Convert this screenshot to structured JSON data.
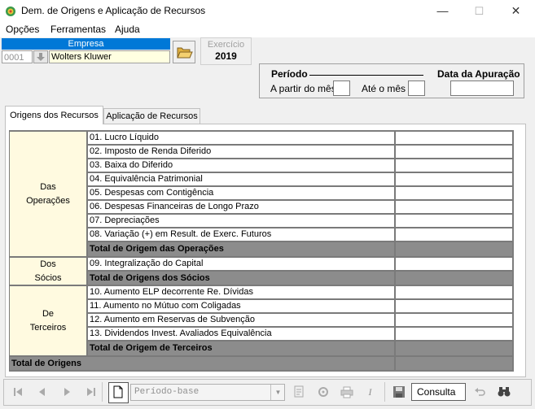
{
  "window": {
    "title": "Dem. de Origens e Aplicação de Recursos",
    "minimize": "—",
    "maximize": "☐",
    "close": "✕"
  },
  "menu": [
    {
      "label": "Opções"
    },
    {
      "label": "Ferramentas"
    },
    {
      "label": "Ajuda"
    }
  ],
  "empresa": {
    "header": "Empresa",
    "code": "0001",
    "name": "Wolters Kluwer"
  },
  "exercicio": {
    "label": "Exercício",
    "value": "2019"
  },
  "periodo": {
    "label": "Período",
    "data_apuracao_label": "Data da Apuração",
    "a_partir_label": "A partir do mês",
    "ate_label": "Até o mês",
    "a_partir_value": "",
    "ate_value": "",
    "apuracao_value": ""
  },
  "tabs": [
    {
      "label": "Origens dos Recursos",
      "active": true
    },
    {
      "label": "Aplicação de Recursos",
      "active": false
    }
  ],
  "groups": {
    "operacoes": {
      "line1": "Das",
      "line2": "Operações"
    },
    "socios": {
      "line1": "Dos",
      "line2": "Sócios"
    },
    "terceiros": {
      "line1": "De",
      "line2": "Terceiros"
    }
  },
  "rows": [
    {
      "label": "01.  Lucro Líquido",
      "value": ""
    },
    {
      "label": "02.  Imposto de Renda Diferido",
      "value": ""
    },
    {
      "label": "03.  Baixa do Diferido",
      "value": ""
    },
    {
      "label": "04.  Equivalência Patrimonial",
      "value": ""
    },
    {
      "label": "05.  Despesas com Contigência",
      "value": ""
    },
    {
      "label": "06.  Despesas Financeiras de Longo Prazo",
      "value": ""
    },
    {
      "label": "07.  Depreciações",
      "value": ""
    },
    {
      "label": "08.  Variação (+) em Result. de Exerc. Futuros",
      "value": ""
    },
    {
      "label": "Total de Origem das Operações",
      "value": "",
      "total": true
    },
    {
      "label": "09.  Integralização do Capital",
      "value": ""
    },
    {
      "label": "Total de Origens dos Sócios",
      "value": "",
      "total": true
    },
    {
      "label": "10.  Aumento ELP decorrente Re. Dívidas",
      "value": ""
    },
    {
      "label": "11.  Aumento no Mútuo com Coligadas",
      "value": ""
    },
    {
      "label": "12.  Aumento em Reservas de Subvenção",
      "value": ""
    },
    {
      "label": "13.  Dividendos Invest. Avaliados Equivalência",
      "value": ""
    },
    {
      "label": "Total de Origem de Terceiros",
      "value": "",
      "total": true
    }
  ],
  "grand_total": {
    "label": "Total de Origens",
    "value": ""
  },
  "toolbar": {
    "periodo_base_placeholder": "Período-base",
    "consulta": "Consulta"
  }
}
